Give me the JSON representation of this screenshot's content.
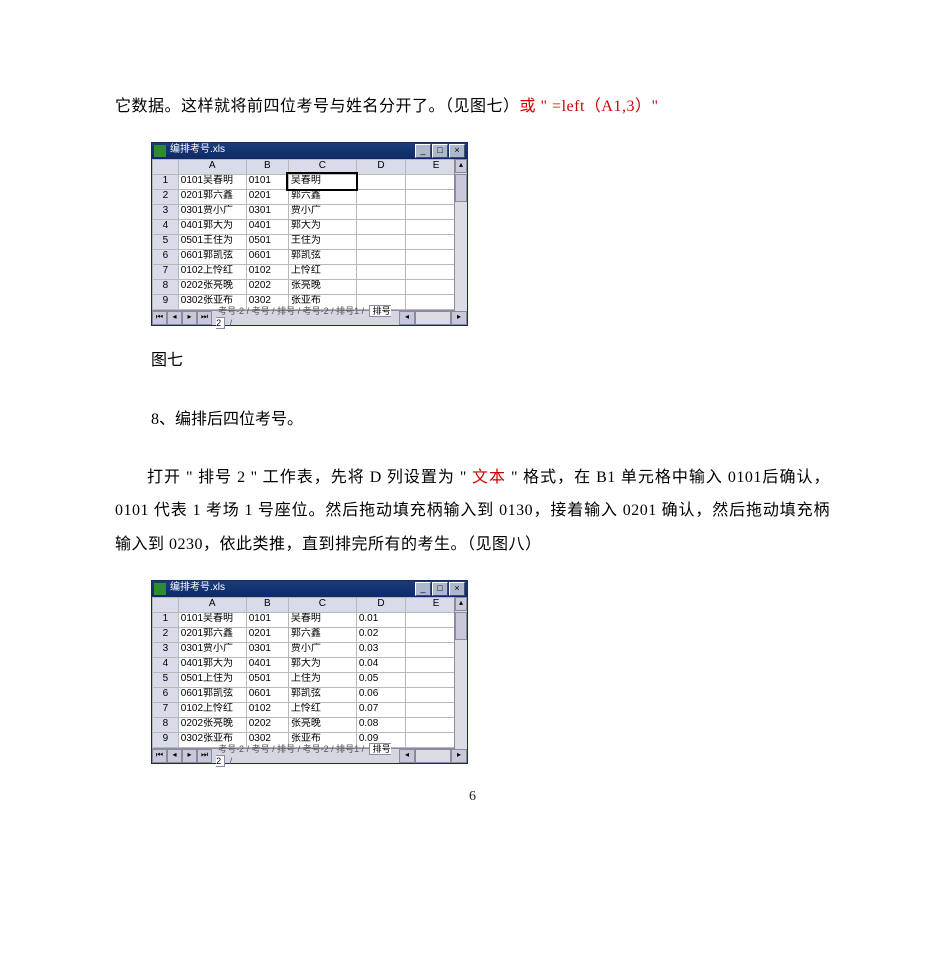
{
  "para1_before": "它数据。这样就将前四位考号与姓名分开了。（见图七）",
  "para1_red": "或 \" =left（A1,3）\"",
  "caption7": "图七",
  "heading8": "8、编排后四位考号。",
  "para2_a": "打开 \" 排号 2 \" 工作表，先将 D 列设置为 \" ",
  "para2_red": "文本",
  "para2_b": " \" 格式，在 B1 单元格中输入 0101后确认，0101 代表 1 考场 1 号座位。然后拖动填充柄输入到 0130，接着输入 0201 确认，然后拖动填充柄输入到 0230，依此类推，直到排完所有的考生。（见图八）",
  "page_number": "6",
  "excel7": {
    "title": "编排考号.xls",
    "cols": [
      "A",
      "B",
      "C",
      "D",
      "E"
    ],
    "rows": [
      {
        "n": "1",
        "a": "0101吴春明",
        "b": "0101",
        "c": "吴春明",
        "d": "",
        "e": ""
      },
      {
        "n": "2",
        "a": "0201郭六鑫",
        "b": "0201",
        "c": "郭六鑫",
        "d": "",
        "e": ""
      },
      {
        "n": "3",
        "a": "0301贾小广",
        "b": "0301",
        "c": "贾小广",
        "d": "",
        "e": ""
      },
      {
        "n": "4",
        "a": "0401郭大为",
        "b": "0401",
        "c": "郭大为",
        "d": "",
        "e": ""
      },
      {
        "n": "5",
        "a": "0501王住为",
        "b": "0501",
        "c": "王住为",
        "d": "",
        "e": ""
      },
      {
        "n": "6",
        "a": "0601郭凯弦",
        "b": "0601",
        "c": "郭凯弦",
        "d": "",
        "e": ""
      },
      {
        "n": "7",
        "a": "0102上怜红",
        "b": "0102",
        "c": "上怜红",
        "d": "",
        "e": ""
      },
      {
        "n": "8",
        "a": "0202张亮晚",
        "b": "0202",
        "c": "张亮晚",
        "d": "",
        "e": ""
      },
      {
        "n": "9",
        "a": "0302张亚布",
        "b": "0302",
        "c": "张亚布",
        "d": "",
        "e": ""
      }
    ],
    "tabs_text": "考号-2 / 考号 / 排号 / 考号-2 / 排号1 /",
    "tab_active": "排号2",
    "after_active": "/ "
  },
  "excel8": {
    "title": "编排考号.xls",
    "cols": [
      "A",
      "B",
      "C",
      "D",
      "E"
    ],
    "rows": [
      {
        "n": "1",
        "a": "0101吴春明",
        "b": "0101",
        "c": "吴春明",
        "d": "0.01",
        "e": ""
      },
      {
        "n": "2",
        "a": "0201郭六鑫",
        "b": "0201",
        "c": "郭六鑫",
        "d": "0.02",
        "e": ""
      },
      {
        "n": "3",
        "a": "0301贾小广",
        "b": "0301",
        "c": "贾小广",
        "d": "0.03",
        "e": ""
      },
      {
        "n": "4",
        "a": "0401郭大为",
        "b": "0401",
        "c": "郭大为",
        "d": "0.04",
        "e": ""
      },
      {
        "n": "5",
        "a": "0501上住为",
        "b": "0501",
        "c": "上住为",
        "d": "0.05",
        "e": ""
      },
      {
        "n": "6",
        "a": "0601郭凯弦",
        "b": "0601",
        "c": "郭凯弦",
        "d": "0.06",
        "e": ""
      },
      {
        "n": "7",
        "a": "0102上怜红",
        "b": "0102",
        "c": "上怜红",
        "d": "0.07",
        "e": ""
      },
      {
        "n": "8",
        "a": "0202张亮晚",
        "b": "0202",
        "c": "张亮晚",
        "d": "0.08",
        "e": ""
      },
      {
        "n": "9",
        "a": "0302张亚布",
        "b": "0302",
        "c": "张亚布",
        "d": "0.09",
        "e": ""
      }
    ],
    "tabs_text": "考号-2 / 考号 / 排号 / 考号-2 / 排号1 /",
    "tab_active": "排号2",
    "after_active": "/ "
  }
}
